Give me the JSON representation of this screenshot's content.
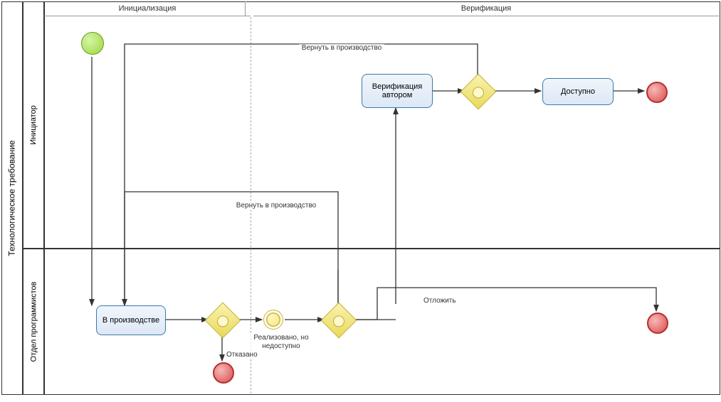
{
  "pool": {
    "name": "Технологическое требование"
  },
  "lanes": {
    "initiator": "Инициатор",
    "programmers": "Отдел программистов"
  },
  "phases": {
    "init": "Инициализация",
    "verify": "Верификация"
  },
  "tasks": {
    "in_production": "В производстве",
    "verify_author": "Верификация автором",
    "available": "Доступно"
  },
  "events": {
    "realized_unavailable": "Реализовано, но недоступно"
  },
  "flow_labels": {
    "return_prod_top": "Вернуть в производство",
    "return_prod_mid": "Вернуть в производство",
    "refused": "Отказано",
    "postpone": "Отложить"
  }
}
